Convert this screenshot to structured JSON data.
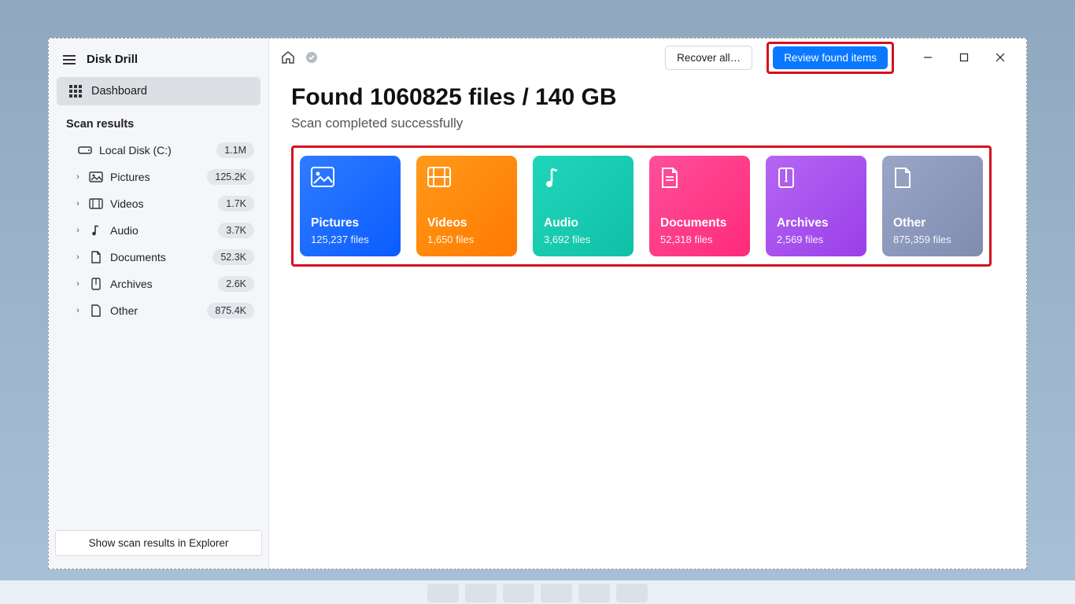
{
  "app": {
    "title": "Disk Drill"
  },
  "sidebar": {
    "dashboard_label": "Dashboard",
    "section_label": "Scan results",
    "root": {
      "label": "Local Disk (C:)",
      "count": "1.1M"
    },
    "items": [
      {
        "label": "Pictures",
        "count": "125.2K"
      },
      {
        "label": "Videos",
        "count": "1.7K"
      },
      {
        "label": "Audio",
        "count": "3.7K"
      },
      {
        "label": "Documents",
        "count": "52.3K"
      },
      {
        "label": "Archives",
        "count": "2.6K"
      },
      {
        "label": "Other",
        "count": "875.4K"
      }
    ],
    "footer_button": "Show scan results in Explorer"
  },
  "toolbar": {
    "recover_label": "Recover all…",
    "review_label": "Review found items"
  },
  "summary": {
    "headline": "Found 1060825 files / 140 GB",
    "subline": "Scan completed successfully"
  },
  "cards": [
    {
      "key": "pictures",
      "title": "Pictures",
      "count": "125,237 files"
    },
    {
      "key": "videos",
      "title": "Videos",
      "count": "1,650 files"
    },
    {
      "key": "audio",
      "title": "Audio",
      "count": "3,692 files"
    },
    {
      "key": "documents",
      "title": "Documents",
      "count": "52,318 files"
    },
    {
      "key": "archives",
      "title": "Archives",
      "count": "2,569 files"
    },
    {
      "key": "other",
      "title": "Other",
      "count": "875,359 files"
    }
  ]
}
